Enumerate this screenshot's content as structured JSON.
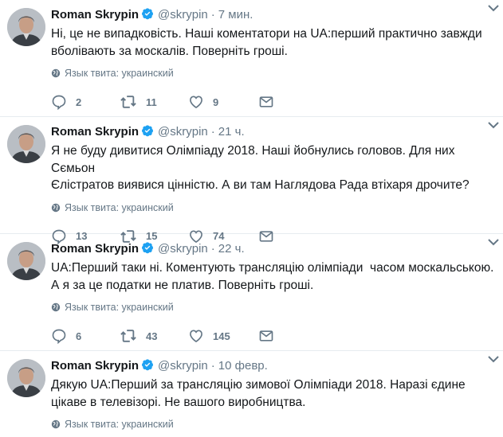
{
  "tweets": [
    {
      "author": "Roman Skrypin",
      "handle": "@skrypin",
      "separator": "·",
      "time": "7 мин.",
      "text": "Ні, це не випадковість. Наші коментатори на UA:перший практично завжди\nвболівають за москалів. Поверніть гроші.",
      "language": "Язык твита: украинский",
      "replies": "2",
      "retweets": "11",
      "likes": "9"
    },
    {
      "author": "Roman Skrypin",
      "handle": "@skrypin",
      "separator": "·",
      "time": "21 ч.",
      "text": "Я не буду дивитися Олімпіаду 2018. Наші йобнулись головов. Для них Сємьон\nЄлістратов виявися цінністю. А ви там Наглядова Рада втіхаря дрочите?",
      "language": "Язык твита: украинский",
      "replies": "13",
      "retweets": "15",
      "likes": "74"
    },
    {
      "author": "Roman Skrypin",
      "handle": "@skrypin",
      "separator": "·",
      "time": "22 ч.",
      "text": "UA:Перший таки ні. Коментують трансляцію олімпіади  часом москальською.\nА я за це податки не платив. Поверніть гроші.",
      "language": "Язык твита: украинский",
      "replies": "6",
      "retweets": "43",
      "likes": "145"
    },
    {
      "author": "Roman Skrypin",
      "handle": "@skrypin",
      "separator": "·",
      "time": "10 февр.",
      "text": "Дякую UA:Перший за трансляцію зимової Олімпіади 2018. Наразі єдине\nцікаве в телевізорі. Не вашого виробництва.",
      "language": "Язык твита: украинский"
    }
  ],
  "colors": {
    "verified": "#1da1f2",
    "muted": "#657786",
    "text": "#14171a",
    "divider": "#e6ecf0"
  },
  "icons": [
    "verified-badge-icon",
    "chevron-down-icon",
    "globe-icon",
    "reply-icon",
    "retweet-icon",
    "like-icon",
    "direct-message-icon"
  ]
}
